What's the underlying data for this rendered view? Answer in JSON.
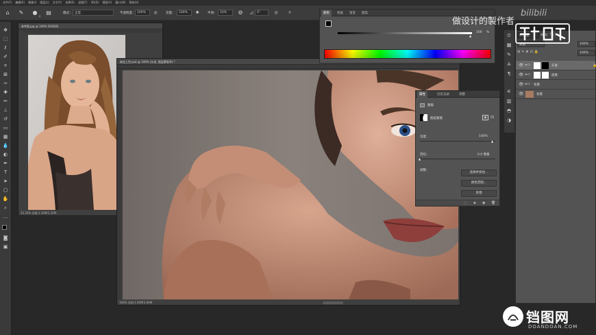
{
  "menubar": {
    "items": [
      "文件(F)",
      "编辑(E)",
      "图像(I)",
      "图层(L)",
      "文字(Y)",
      "选择(S)",
      "滤镜(T)",
      "3D(D)",
      "视图(V)",
      "窗口(W)",
      "帮助(H)"
    ]
  },
  "options": {
    "mode_label": "模式：",
    "mode_value": "正常",
    "opacity_label": "不透明度：",
    "opacity_value": "100%",
    "flow_label": "流量：",
    "flow_value": "100%",
    "smooth_label": "平滑：",
    "smooth_value": "10%",
    "angle_value": "0°",
    "brush_size": "9"
  },
  "tools": [
    "move-icon",
    "marquee-icon",
    "lasso-icon",
    "quick-select-icon",
    "crop-icon",
    "frame-icon",
    "eyedropper-icon",
    "healing-icon",
    "brush-icon",
    "stamp-icon",
    "history-brush-icon",
    "eraser-icon",
    "gradient-icon",
    "blur-icon",
    "dodge-icon",
    "pen-icon",
    "type-icon",
    "path-select-icon",
    "shape-icon",
    "hand-icon",
    "zoom-icon",
    "more-icon"
  ],
  "doc1": {
    "title": "参考图.jpg @ 100% (RGB/8)",
    "status": "33.33%   文档:1.31M/1.31M"
  },
  "doc2": {
    "title": "商业上色.psd @ 100% (头发, 图层蒙版/8) *",
    "status": "100%   文档:1.92M/3.64M"
  },
  "color_panel": {
    "tabs": [
      "颜色",
      "色板",
      "渐变",
      "图案"
    ],
    "slider_value": "100",
    "slider_unit": "%",
    "accent_spectrum": [
      "#ff0000",
      "#ffff00",
      "#00ff00",
      "#00ffff",
      "#0000ff",
      "#ff00ff",
      "#ff0000"
    ]
  },
  "props_panel": {
    "tabs": [
      "属性",
      "历史记录",
      "调整"
    ],
    "section_label": "蒙版",
    "mask_type": "图层蒙版",
    "density_label": "浓度：",
    "density_value": "100%",
    "feather_label": "羽化：",
    "feather_value": "0.0 像素",
    "refine_label": "调整：",
    "buttons": [
      "选择并遮住...",
      "颜色范围...",
      "反相"
    ]
  },
  "layers_panel": {
    "blend_mode": "穿透",
    "opacity_value": "100%",
    "fill_value": "100%",
    "layers": [
      {
        "name": "头发",
        "selected": true
      },
      {
        "name": "皮肤",
        "selected": false
      },
      {
        "name": "背景",
        "selected": false
      },
      {
        "name": "背景",
        "selected": false
      }
    ]
  },
  "watermark": {
    "headline": "做设计的製作者",
    "site_name": "铛图网",
    "site_url": "DOANDOAN.COM",
    "bilibili": "bilibili"
  }
}
